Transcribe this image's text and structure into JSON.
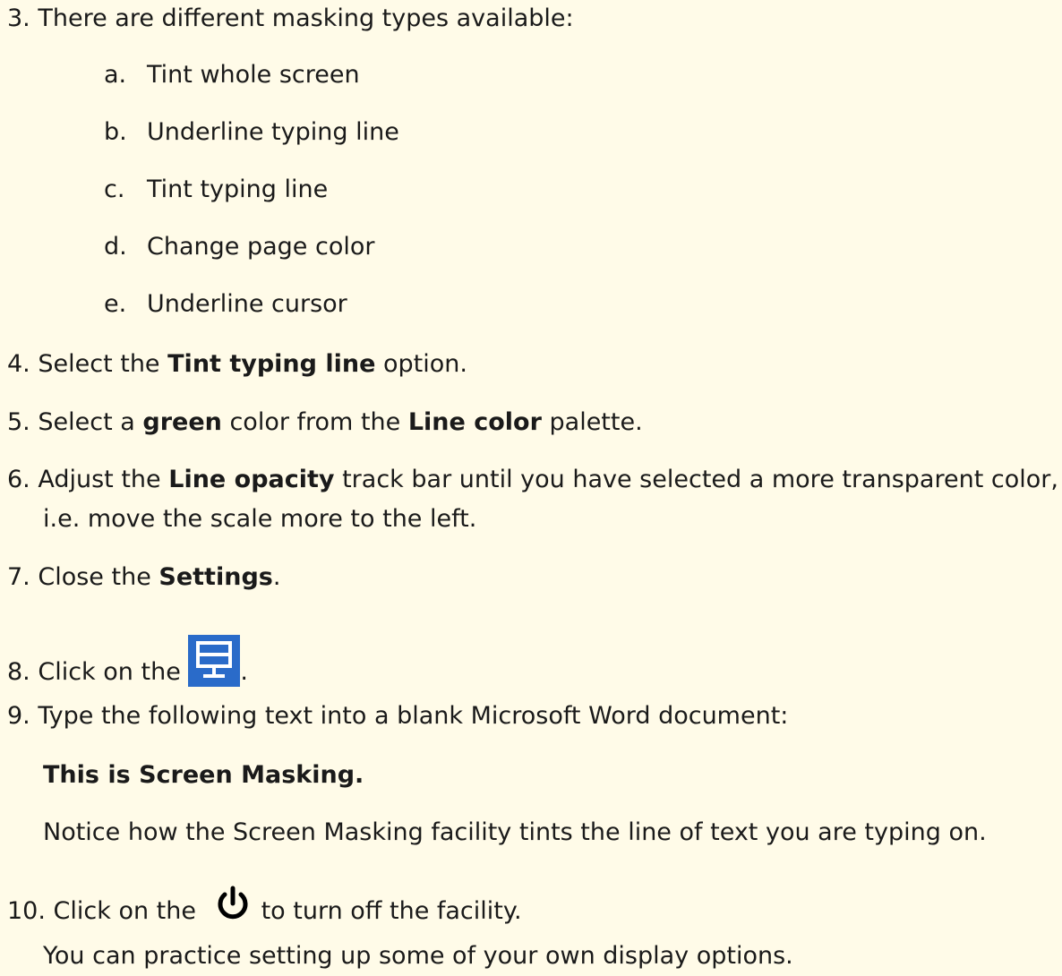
{
  "step3": {
    "number": "3.",
    "text": "There are different masking types available:"
  },
  "masking_types": [
    {
      "letter": "a.",
      "text": "Tint whole screen"
    },
    {
      "letter": "b.",
      "text": "Underline typing line"
    },
    {
      "letter": "c.",
      "text": "Tint typing line"
    },
    {
      "letter": "d.",
      "text": "Change page color"
    },
    {
      "letter": "e.",
      "text": "Underline cursor"
    }
  ],
  "step4": {
    "number": "4.",
    "pre": "Select the ",
    "bold": "Tint typing line",
    "post": " option."
  },
  "step5": {
    "number": "5.",
    "pre": "Select a ",
    "bold1": "green",
    "mid": " color from the ",
    "bold2": "Line color",
    "post": " palette."
  },
  "step6": {
    "number": "6.",
    "pre": "Adjust the ",
    "bold": "Line opacity",
    "post": " track bar until you have selected a more transparent color,",
    "line2": "i.e. move the scale more to the left."
  },
  "step7": {
    "number": "7.",
    "pre": "Close the ",
    "bold": "Settings",
    "post": "."
  },
  "step8": {
    "number": "8.",
    "pre": "Click on the ",
    "post": ".",
    "icon": "monitor-icon",
    "icon_color": "#2a6bc9"
  },
  "step9": {
    "number": "9.",
    "text": "Type the following text into a blank Microsoft Word document:",
    "sample": "This is Screen Masking.",
    "notice": "Notice how the Screen Masking facility tints the line of text you are typing on."
  },
  "step10": {
    "number": "10.",
    "pre": "Click on the ",
    "post": "to turn off the facility.",
    "icon": "power-icon",
    "footer": "You can practice setting up some of your own display options."
  },
  "colors": {
    "page_background": "#fffbe8",
    "text": "#1a1a1a"
  }
}
